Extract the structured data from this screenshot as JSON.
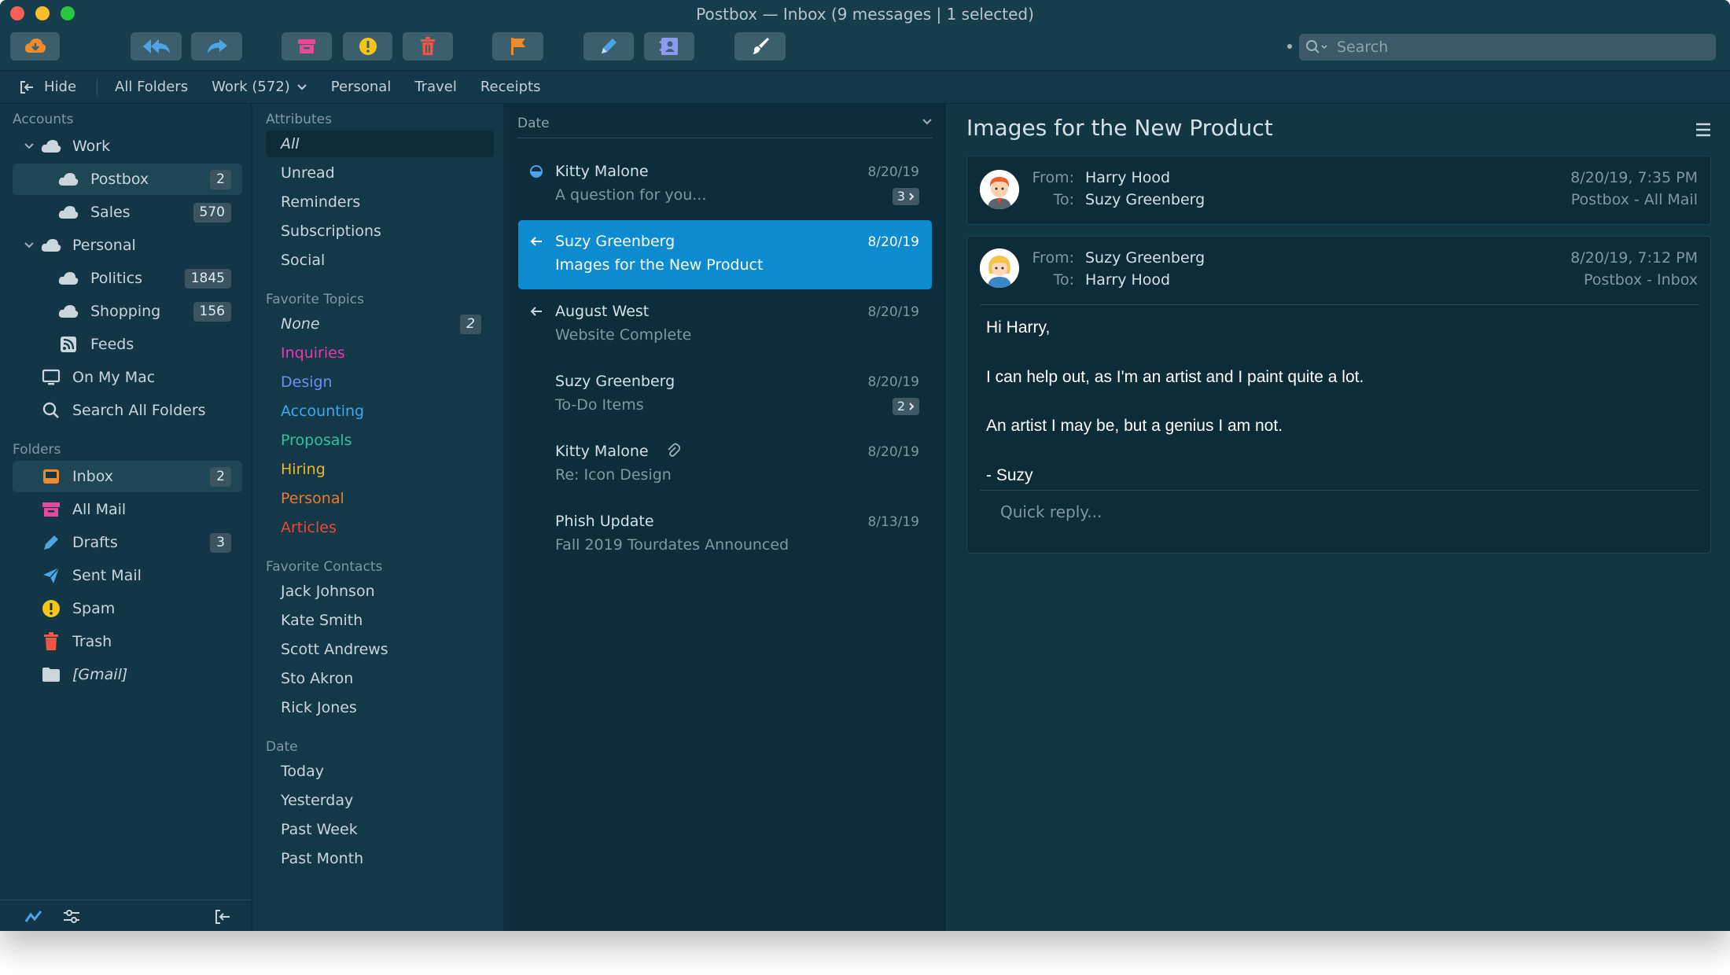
{
  "window": {
    "title": "Postbox — Inbox (9 messages | 1 selected)"
  },
  "toolbar": {
    "buttons": [
      {
        "id": "get-mail",
        "icon": "cloud-download-icon",
        "color": "#f08b2c"
      },
      {
        "id": "reply-all",
        "icon": "reply-all-icon",
        "color": "#4aa6e8"
      },
      {
        "id": "forward",
        "icon": "forward-icon",
        "color": "#4aa6e8"
      },
      {
        "id": "archive",
        "icon": "archive-icon",
        "color": "#e8489a"
      },
      {
        "id": "junk",
        "icon": "warning-icon",
        "color": "#f5c518"
      },
      {
        "id": "delete",
        "icon": "trash-icon",
        "color": "#ef5646"
      },
      {
        "id": "flag",
        "icon": "flag-icon",
        "color": "#f08b2c"
      },
      {
        "id": "compose",
        "icon": "pencil-icon",
        "color": "#4aa6e8"
      },
      {
        "id": "contacts",
        "icon": "address-book-icon",
        "color": "#8b9cf0"
      },
      {
        "id": "customize",
        "icon": "brush-icon",
        "color": "#ffffff"
      }
    ],
    "search_placeholder": "Search"
  },
  "tabs": {
    "hide": "Hide",
    "items": [
      "All Folders",
      "Work (572)",
      "Personal",
      "Travel",
      "Receipts"
    ]
  },
  "sidebar": {
    "accounts_title": "Accounts",
    "accounts": [
      {
        "label": "Work",
        "icon": "cloud-icon",
        "expanded": true
      },
      {
        "label": "Postbox",
        "icon": "cloud-icon",
        "badge": "2"
      },
      {
        "label": "Sales",
        "icon": "cloud-icon",
        "badge": "570"
      },
      {
        "label": "Personal",
        "icon": "cloud-icon",
        "expanded": true
      },
      {
        "label": "Politics",
        "icon": "cloud-icon",
        "badge": "1845"
      },
      {
        "label": "Shopping",
        "icon": "cloud-icon",
        "badge": "156"
      },
      {
        "label": "Feeds",
        "icon": "rss-icon"
      },
      {
        "label": "On My Mac",
        "icon": "monitor-icon"
      },
      {
        "label": "Search All Folders",
        "icon": "search-icon"
      }
    ],
    "folders_title": "Folders",
    "folders": [
      {
        "label": "Inbox",
        "icon": "inbox-icon",
        "badge": "2",
        "color": "#f08b2c"
      },
      {
        "label": "All Mail",
        "icon": "archive-icon",
        "color": "#e8489a"
      },
      {
        "label": "Drafts",
        "icon": "pencil-icon",
        "badge": "3",
        "color": "#4aa6e8"
      },
      {
        "label": "Sent Mail",
        "icon": "paper-plane-icon",
        "color": "#4aa6e8"
      },
      {
        "label": "Spam",
        "icon": "warning-icon",
        "color": "#f5c518"
      },
      {
        "label": "Trash",
        "icon": "trash-icon",
        "color": "#ef5646"
      },
      {
        "label": "[Gmail]",
        "icon": "folder-icon",
        "color": "#c9d6dc"
      }
    ]
  },
  "attributes": {
    "attributes_title": "Attributes",
    "attributes": [
      "All",
      "Unread",
      "Reminders",
      "Subscriptions",
      "Social"
    ],
    "topics_title": "Favorite Topics",
    "topics": [
      {
        "label": "None",
        "color": "#c9d6dc",
        "badge": "2"
      },
      {
        "label": "Inquiries",
        "color": "#e83ab0"
      },
      {
        "label": "Design",
        "color": "#6f8df2"
      },
      {
        "label": "Accounting",
        "color": "#3fa8f0"
      },
      {
        "label": "Proposals",
        "color": "#2dc3a0"
      },
      {
        "label": "Hiring",
        "color": "#f5b41c"
      },
      {
        "label": "Personal",
        "color": "#f07a2c"
      },
      {
        "label": "Articles",
        "color": "#f0443c"
      }
    ],
    "contacts_title": "Favorite Contacts",
    "contacts": [
      "Jack Johnson",
      "Kate Smith",
      "Scott Andrews",
      "Sto Akron",
      "Rick Jones"
    ],
    "date_title": "Date",
    "dates": [
      "Today",
      "Yesterday",
      "Past Week",
      "Past Month"
    ]
  },
  "messages": {
    "sort_label": "Date",
    "items": [
      {
        "sender": "Kitty Malone",
        "subject": "A question for you...",
        "date": "8/20/19",
        "status": "unread",
        "thread": "3"
      },
      {
        "sender": "Suzy Greenberg",
        "subject": "Images for the New Product",
        "date": "8/20/19",
        "status": "replied",
        "selected": true
      },
      {
        "sender": "August West",
        "subject": "Website Complete",
        "date": "8/20/19",
        "status": "replied"
      },
      {
        "sender": "Suzy Greenberg",
        "subject": "To-Do Items",
        "date": "8/20/19",
        "thread": "2"
      },
      {
        "sender": "Kitty Malone",
        "subject": "Re: Icon Design",
        "date": "8/20/19",
        "attachment": true
      },
      {
        "sender": "Phish Update",
        "subject": "Fall 2019 Tourdates Announced",
        "date": "8/13/19"
      }
    ]
  },
  "reader": {
    "title": "Images for the New Product",
    "from_label": "From:",
    "to_label": "To:",
    "message1": {
      "from": "Harry Hood",
      "to": "Suzy Greenberg",
      "date": "8/20/19, 7:35 PM",
      "location": "Postbox - All Mail"
    },
    "message2": {
      "from": "Suzy Greenberg",
      "to": "Harry Hood",
      "date": "8/20/19, 7:12 PM",
      "location": "Postbox - Inbox",
      "body": [
        "Hi Harry,",
        "I can help out, as I'm an artist and I paint quite a lot.",
        "An artist I may be, but a genius I am not.",
        "- Suzy"
      ]
    },
    "quick_reply_placeholder": "Quick reply..."
  }
}
